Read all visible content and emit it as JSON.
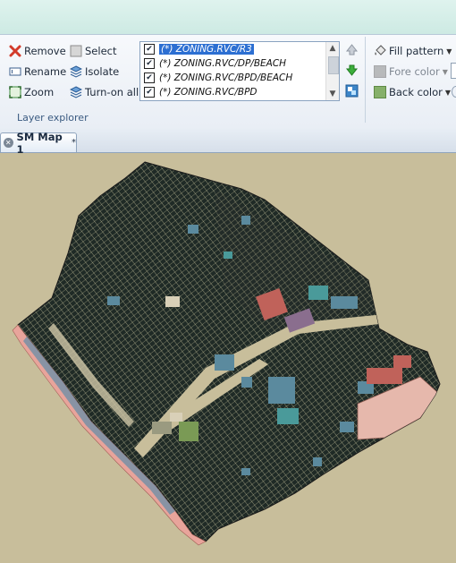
{
  "ribbon": {
    "buttons": {
      "remove": "Remove",
      "select": "Select",
      "rename": "Rename",
      "isolate": "Isolate",
      "zoom": "Zoom",
      "turn_on_all": "Turn-on all",
      "fill_pattern": "Fill pattern",
      "fore_color": "Fore color",
      "back_color": "Back color"
    },
    "group_label": "Layer explorer",
    "layers": [
      {
        "label": "(*) ZONING.RVC/R3",
        "checked": true,
        "selected": true
      },
      {
        "label": "(*) ZONING.RVC/DP/BEACH",
        "checked": true,
        "selected": false
      },
      {
        "label": "(*) ZONING.RVC/BPD/BEACH",
        "checked": true,
        "selected": false
      },
      {
        "label": "(*) ZONING.RVC/BPD",
        "checked": true,
        "selected": false
      }
    ]
  },
  "tabs": [
    {
      "label": "SM Map 1",
      "modified_marker": "*"
    }
  ],
  "colors": {
    "map_background": "#c8be9b",
    "parcel_fill": "#1f2a26",
    "parcel_lines": "#d9d3a8",
    "beach_pink": "#e8a49b",
    "zone_blue": "#5b8a9e",
    "zone_teal": "#4a9a9a",
    "zone_red": "#c0625a",
    "zone_purple": "#8a6e8e",
    "zone_green": "#7a9a55",
    "zone_salmon": "#e6b8ac",
    "highlight_select": "#2c6fd2"
  }
}
